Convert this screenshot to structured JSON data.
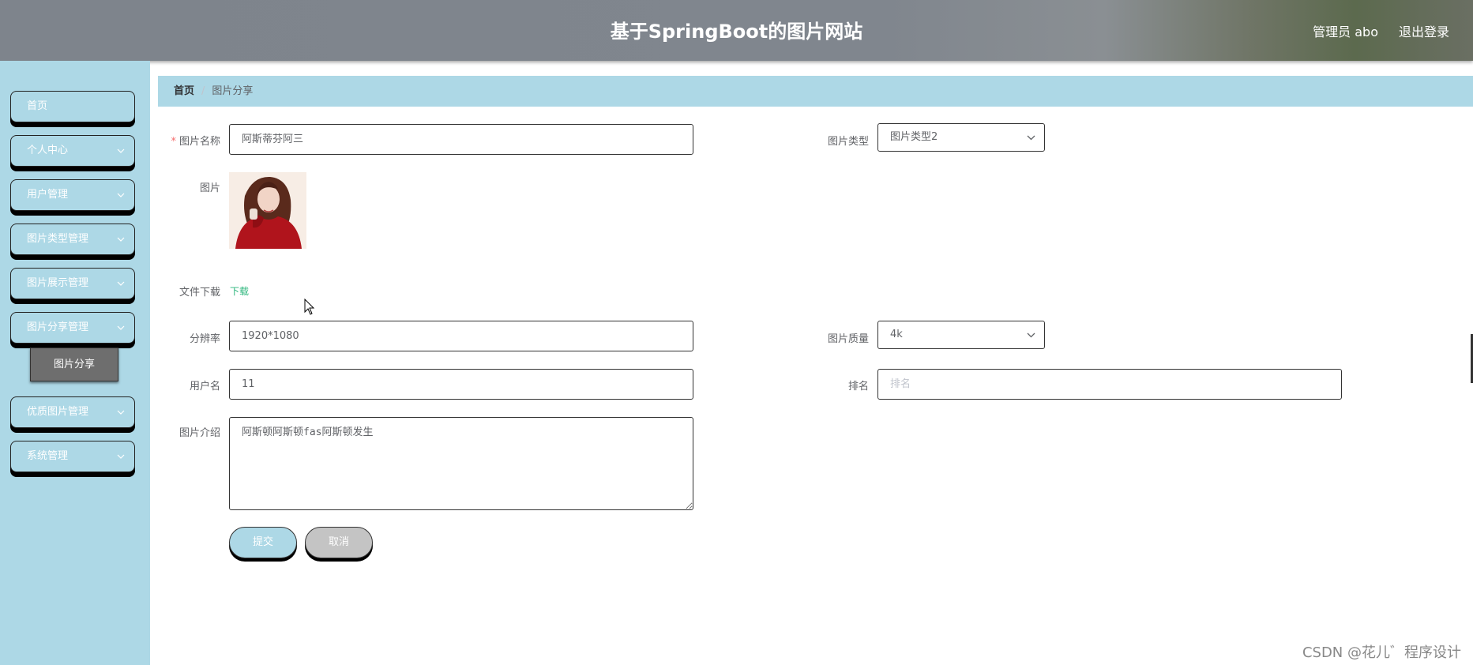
{
  "header": {
    "title": "基于SpringBoot的图片网站",
    "user": "管理员 abo",
    "logout": "退出登录"
  },
  "sidebar": {
    "items": [
      {
        "label": "首页"
      },
      {
        "label": "个人中心"
      },
      {
        "label": "用户管理"
      },
      {
        "label": "图片类型管理"
      },
      {
        "label": "图片展示管理"
      },
      {
        "label": "图片分享管理"
      },
      {
        "label": "优质图片管理"
      },
      {
        "label": "系统管理"
      }
    ],
    "submenu_active": "图片分享"
  },
  "breadcrumb": {
    "home": "首页",
    "separator": "/",
    "current": "图片分享"
  },
  "form": {
    "name_label": "图片名称",
    "name_required": "*",
    "name_value": "阿斯蒂芬阿三",
    "type_label": "图片类型",
    "type_value": "图片类型2",
    "image_label": "图片",
    "download_label": "文件下载",
    "download_link": "下载",
    "resolution_label": "分辨率",
    "resolution_value": "1920*1080",
    "quality_label": "图片质量",
    "quality_value": "4k",
    "username_label": "用户名",
    "username_value": "11",
    "rank_label": "排名",
    "rank_placeholder": "排名",
    "intro_label": "图片介绍",
    "intro_value": "阿斯顿阿斯顿fas阿斯顿发生"
  },
  "buttons": {
    "submit": "提交",
    "cancel": "取消"
  },
  "watermark": "CSDN @花儿゛程序设计",
  "colors": {
    "accent": "#add8e6",
    "header": "#80868e",
    "link": "#2bb57b",
    "required": "#f56c6c"
  }
}
